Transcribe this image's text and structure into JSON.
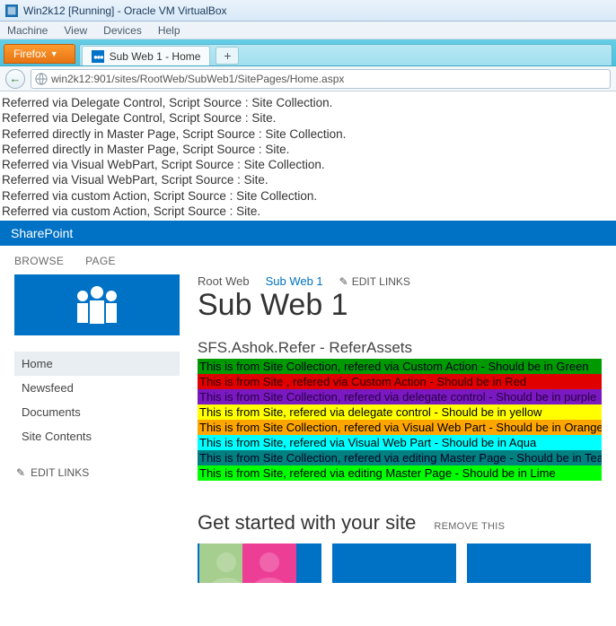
{
  "vbox": {
    "title": "Win2k12 [Running] - Oracle VM VirtualBox",
    "menu": [
      "Machine",
      "View",
      "Devices",
      "Help"
    ]
  },
  "firefox": {
    "button_label": "Firefox",
    "tab_title": "Sub Web 1 - Home",
    "newtab_glyph": "+",
    "back_glyph": "←",
    "url": "win2k12:901/sites/RootWeb/SubWeb1/SitePages/Home.aspx"
  },
  "refs": [
    "Referred via Delegate Control, Script Source : Site Collection.",
    "Referred via Delegate Control, Script Source : Site.",
    "Referred directly in Master Page, Script Source : Site Collection.",
    "Referred directly in Master Page, Script Source : Site.",
    "Referred via Visual WebPart, Script Source : Site Collection.",
    "Referred via Visual WebPart, Script Source : Site.",
    "Referred via custom Action, Script Source : Site Collection.",
    "Referred via custom Action, Script Source : Site."
  ],
  "sp": {
    "suite": "SharePoint",
    "ribbon": {
      "browse": "BROWSE",
      "page": "PAGE"
    },
    "nav": {
      "items": [
        "Home",
        "Newsfeed",
        "Documents",
        "Site Contents"
      ],
      "edit_links": "EDIT LINKS"
    },
    "crumbs": {
      "root": "Root Web",
      "current": "Sub Web 1",
      "edit": "EDIT LINKS"
    },
    "title": "Sub Web 1",
    "webpart_title": "SFS.Ashok.Refer - ReferAssets",
    "lines": {
      "green": "This is from Site Collection, refered via Custom Action - Should be in Green",
      "red": "This is from Site , refered via Custom Action - Should be in Red",
      "purple": "This is from Site Collection, refered via delegate control - Should be in purple",
      "yellow": "This is from Site, refered via delegate control - Should be in yellow",
      "orange": "This is from Site Collection, refered via Visual Web Part - Should be in Orange",
      "aqua": "This is from Site, refered via Visual Web Part - Should be in Aqua",
      "teal": "This is from Site Collection, refered via editing Master Page - Should be in Teal",
      "lime": "This is from Site, refered via editing Master Page - Should be in Lime"
    },
    "promo": {
      "heading": "Get started with your site",
      "remove": "REMOVE THIS"
    }
  }
}
